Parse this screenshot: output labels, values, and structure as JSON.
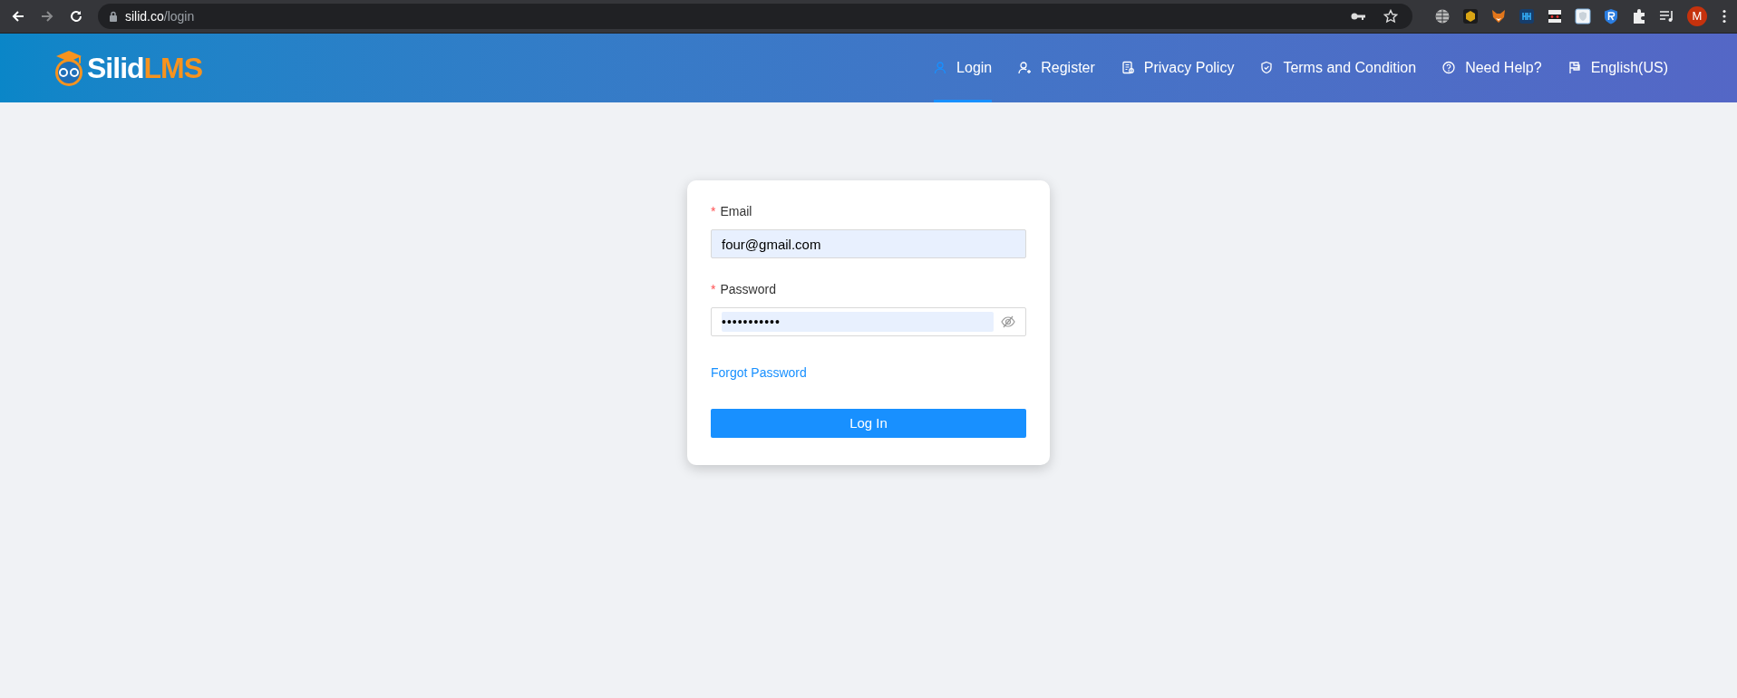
{
  "browser": {
    "url_host": "silid.co",
    "url_path": "/login",
    "profile_initial": "M"
  },
  "logo": {
    "first": "Silid",
    "second": "LMS"
  },
  "nav": [
    {
      "kind": "user",
      "label": "Login",
      "selected": true
    },
    {
      "kind": "user-plus",
      "label": "Register",
      "selected": false
    },
    {
      "kind": "document",
      "label": "Privacy Policy",
      "selected": false
    },
    {
      "kind": "shield",
      "label": "Terms and Condition",
      "selected": false
    },
    {
      "kind": "help",
      "label": "Need Help?",
      "selected": false
    },
    {
      "kind": "flag",
      "label": "English(US)",
      "selected": false
    }
  ],
  "form": {
    "fields": [
      {
        "kind": "text",
        "label": "Email",
        "required_mark": "*",
        "value": "four@gmail.com"
      },
      {
        "kind": "password",
        "label": "Password",
        "required_mark": "*",
        "value": "•••••••••••"
      }
    ],
    "forgot_link": "Forgot Password",
    "submit": "Log In"
  }
}
